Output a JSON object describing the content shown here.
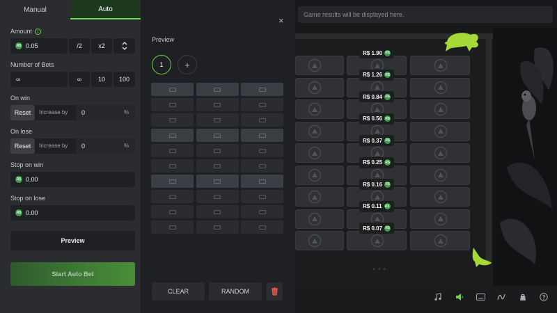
{
  "tabs": {
    "manual": "Manual",
    "auto": "Auto"
  },
  "left": {
    "amount_label": "Amount",
    "info_icon": "i",
    "coin_symbol": "R$",
    "amount_value": "0.05",
    "half_label": "/2",
    "double_label": "x2",
    "bets_label": "Number of Bets",
    "bets_value": "∞",
    "bets_opt_inf": "∞",
    "bets_opt_10": "10",
    "bets_opt_100": "100",
    "on_win_label": "On win",
    "on_lose_label": "On lose",
    "reset_label": "Reset",
    "increase_label": "Increase by",
    "win_increase_value": "0",
    "lose_increase_value": "0",
    "pct": "%",
    "stop_win_label": "Stop on win",
    "stop_win_value": "0.00",
    "stop_lose_label": "Stop on lose",
    "stop_lose_value": "0.00",
    "preview_button": "Preview",
    "start_button": "Start Auto Bet"
  },
  "mid": {
    "title": "Preview",
    "close": "×",
    "round_label": "1",
    "add_label": "+",
    "highlighted_rows": [
      0,
      3,
      6
    ],
    "clear_label": "CLEAR",
    "random_label": "RANDOM"
  },
  "game": {
    "results_placeholder": "Game results will be displayed here.",
    "multipliers": [
      "R$ 1.90",
      "R$ 1.26",
      "R$ 0.84",
      "R$ 0.56",
      "R$ 0.37",
      "R$ 0.25",
      "R$ 0.16",
      "R$ 0.11",
      "R$ 0.07"
    ],
    "footer_icons": [
      "music-icon",
      "sound-icon",
      "keyboard-icon",
      "fairness-icon",
      "bag-icon",
      "help-icon"
    ]
  },
  "colors": {
    "accent": "#76d35a",
    "panel": "#2a2c30",
    "start": "#3d7935"
  }
}
